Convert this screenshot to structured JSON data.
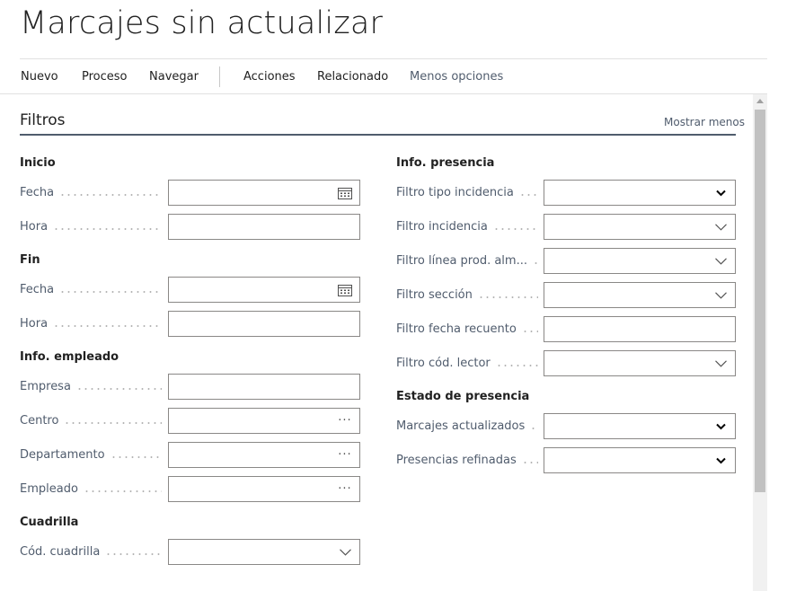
{
  "page": {
    "title": "Marcajes sin actualizar"
  },
  "actions": {
    "nuevo": "Nuevo",
    "proceso": "Proceso",
    "navegar": "Navegar",
    "acciones": "Acciones",
    "relacionado": "Relacionado",
    "menos_opciones": "Menos opciones"
  },
  "filtros": {
    "title": "Filtros",
    "toggle": "Mostrar menos",
    "inicio": {
      "title": "Inicio",
      "fecha": "Fecha",
      "hora": "Hora"
    },
    "fin": {
      "title": "Fin",
      "fecha": "Fecha",
      "hora": "Hora"
    },
    "empleado": {
      "title": "Info. empleado",
      "empresa": "Empresa",
      "centro": "Centro",
      "departamento": "Departamento",
      "empleado": "Empleado"
    },
    "cuadrilla": {
      "title": "Cuadrilla",
      "cod_cuadrilla": "Cód. cuadrilla"
    },
    "presencia": {
      "title": "Info. presencia",
      "tipo_incidencia": "Filtro tipo incidencia",
      "incidencia": "Filtro incidencia",
      "linea_prod": "Filtro línea prod. alm...",
      "seccion": "Filtro sección",
      "fecha_recuento": "Filtro fecha recuento",
      "cod_lector": "Filtro cód. lector"
    },
    "estado": {
      "title": "Estado de presencia",
      "marcajes_actualizados": "Marcajes actualizados",
      "presencias_refinadas": "Presencias refinadas"
    }
  }
}
